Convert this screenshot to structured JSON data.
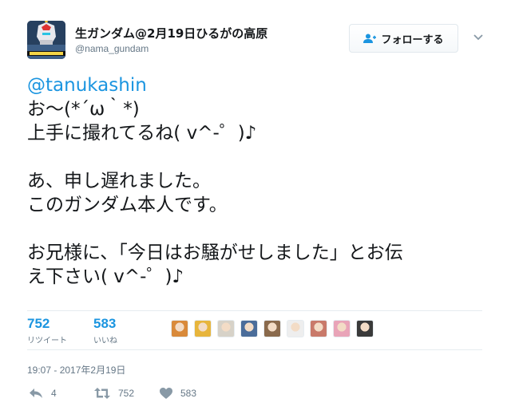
{
  "user": {
    "display_name": "生ガンダム@2月19日ひるがの高原",
    "handle": "@nama_gundam"
  },
  "header": {
    "follow_label": "フォローする",
    "follow_icon": "add-user-icon",
    "menu_icon": "chevron-down-icon"
  },
  "tweet": {
    "mention": "@tanukashin",
    "lines": [
      "お〜(*´ω｀*)",
      "上手に撮れてるね( v^-゜)♪",
      "",
      "あ、申し遅れました。",
      "このガンダム本人です。",
      "",
      "お兄様に、「今日はお騒がせしました」とお伝",
      "え下さい( v^-゜)♪"
    ]
  },
  "stats": {
    "retweets": "752",
    "retweets_label": "リツイート",
    "likes": "583",
    "likes_label": "いいね"
  },
  "likers": [
    {
      "name": "liker-avatar-1",
      "color": "#d98a3a"
    },
    {
      "name": "liker-avatar-2",
      "color": "#e7b53c"
    },
    {
      "name": "liker-avatar-3",
      "color": "#d7d2c8"
    },
    {
      "name": "liker-avatar-4",
      "color": "#4b6d9a"
    },
    {
      "name": "liker-avatar-5",
      "color": "#8a6a4c"
    },
    {
      "name": "liker-avatar-6",
      "color": "#eeeeee"
    },
    {
      "name": "liker-avatar-7",
      "color": "#c97a6a"
    },
    {
      "name": "liker-avatar-8",
      "color": "#e9a4b8"
    },
    {
      "name": "liker-avatar-9",
      "color": "#3a3a3a"
    }
  ],
  "timestamp": "19:07 - 2017年2月19日",
  "actions": {
    "reply_count": "4",
    "retweet_count": "752",
    "like_count": "583"
  },
  "colors": {
    "accent": "#1b95e0",
    "muted": "#657786",
    "text": "#14171a"
  }
}
